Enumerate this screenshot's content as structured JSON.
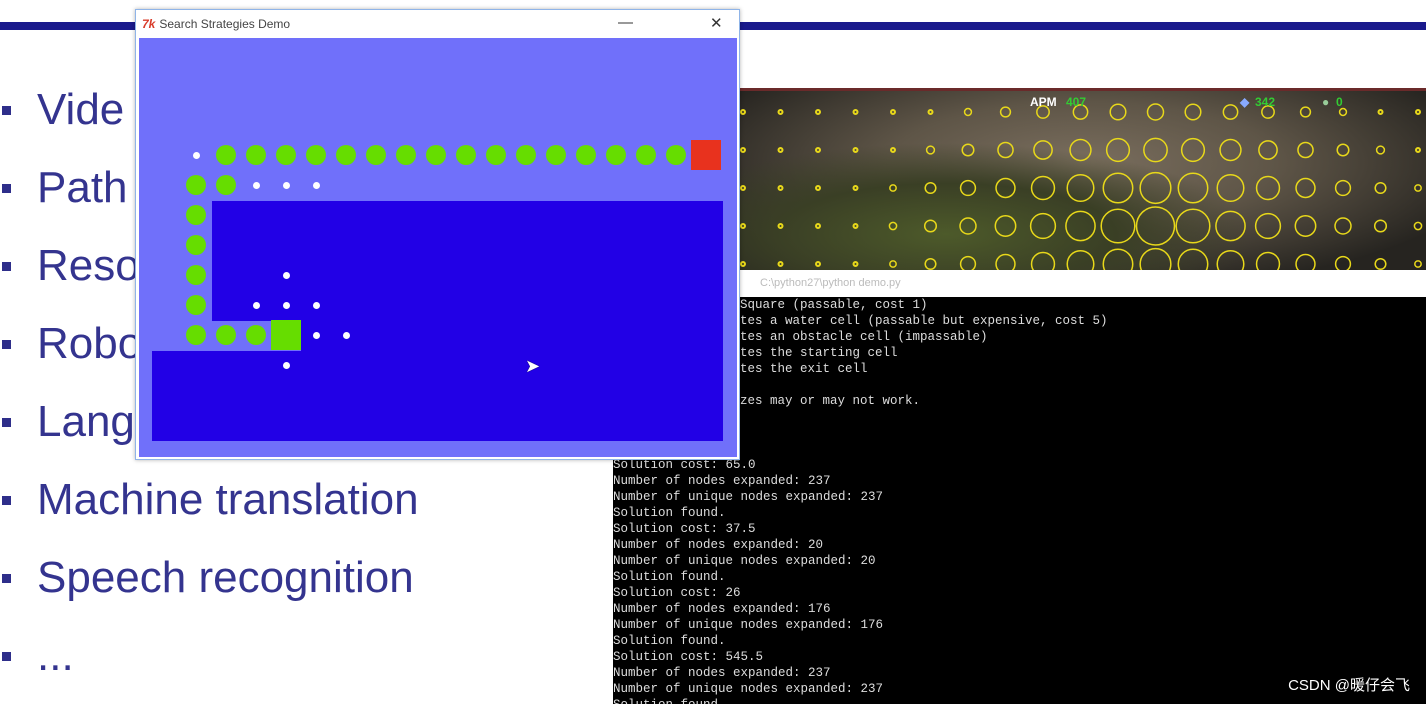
{
  "slide": {
    "bullets": [
      "Vide",
      "Path",
      "Reso",
      "Robo",
      "Lang",
      "Machine translation",
      "Speech recognition",
      "..."
    ]
  },
  "demo_window": {
    "icon": "tk-feather-icon",
    "title": "Search Strategies Demo",
    "minimize": "—",
    "close": "✕",
    "colors": {
      "open": "#7070fa",
      "obstacle": "#2200e6",
      "path": "#66dd00",
      "exit": "#e8321e",
      "expanded": "#ffffff"
    }
  },
  "game": {
    "apm_label": "APM",
    "apm_value": "407",
    "minerals": "342",
    "gas": "0"
  },
  "terminal": {
    "title": "C:\\python27\\python demo.py",
    "lines": [
      "Square (passable, cost 1)",
      "tes a water cell (passable but expensive, cost 5)",
      "tes an obstacle cell (impassable)",
      "tes the starting cell",
      "tes the exit cell",
      "",
      "zes may or may not work.",
      "",
      "",
      "",
      "Solution cost: 65.0",
      "Number of nodes expanded: 237",
      "Number of unique nodes expanded: 237",
      "Solution found.",
      "Solution cost: 37.5",
      "Number of nodes expanded: 20",
      "Number of unique nodes expanded: 20",
      "Solution found.",
      "Solution cost: 26",
      "Number of nodes expanded: 176",
      "Number of unique nodes expanded: 176",
      "Solution found.",
      "Solution cost: 545.5",
      "Number of nodes expanded: 237",
      "Number of unique nodes expanded: 237",
      "Solution found."
    ]
  },
  "watermark": "CSDN @暖仔会飞"
}
